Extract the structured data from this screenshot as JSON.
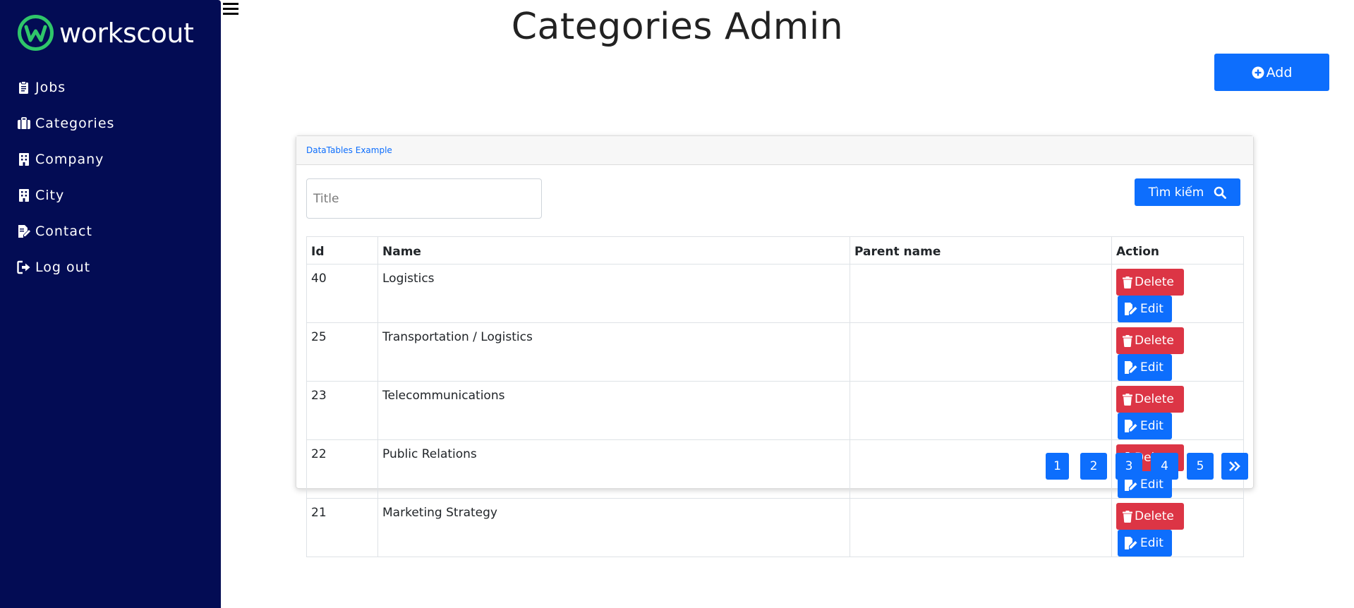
{
  "brand": {
    "name": "workscout"
  },
  "sidebar": {
    "items": [
      {
        "label": "Jobs",
        "icon": "clipboard-icon"
      },
      {
        "label": "Categories",
        "icon": "briefcase-icon"
      },
      {
        "label": "Company",
        "icon": "building-icon"
      },
      {
        "label": "City",
        "icon": "building-icon"
      },
      {
        "label": "Contact",
        "icon": "file-signature-icon"
      },
      {
        "label": "Log out",
        "icon": "logout-icon"
      }
    ]
  },
  "header": {
    "title": "Categories Admin",
    "add_label": "Add"
  },
  "card": {
    "title": "DataTables Example",
    "search_placeholder": "Title",
    "search_label": "Tìm kiếm"
  },
  "table": {
    "columns": [
      "Id",
      "Name",
      "Parent name",
      "Action"
    ],
    "rows": [
      {
        "id": "40",
        "name": "Logistics",
        "parent": ""
      },
      {
        "id": "25",
        "name": "Transportation / Logistics",
        "parent": ""
      },
      {
        "id": "23",
        "name": "Telecommunications",
        "parent": ""
      },
      {
        "id": "22",
        "name": "Public Relations",
        "parent": ""
      },
      {
        "id": "21",
        "name": "Marketing Strategy",
        "parent": ""
      }
    ],
    "delete_label": "Delete",
    "edit_label": "Edit"
  },
  "pagination": {
    "pages": [
      "1",
      "2",
      "3",
      "4",
      "5"
    ],
    "next_icon": "double-chevron-right-icon"
  },
  "colors": {
    "sidebar": "#030c54",
    "primary": "#0d6efd",
    "danger": "#dc3545",
    "brand_green": "#2fc66a"
  }
}
